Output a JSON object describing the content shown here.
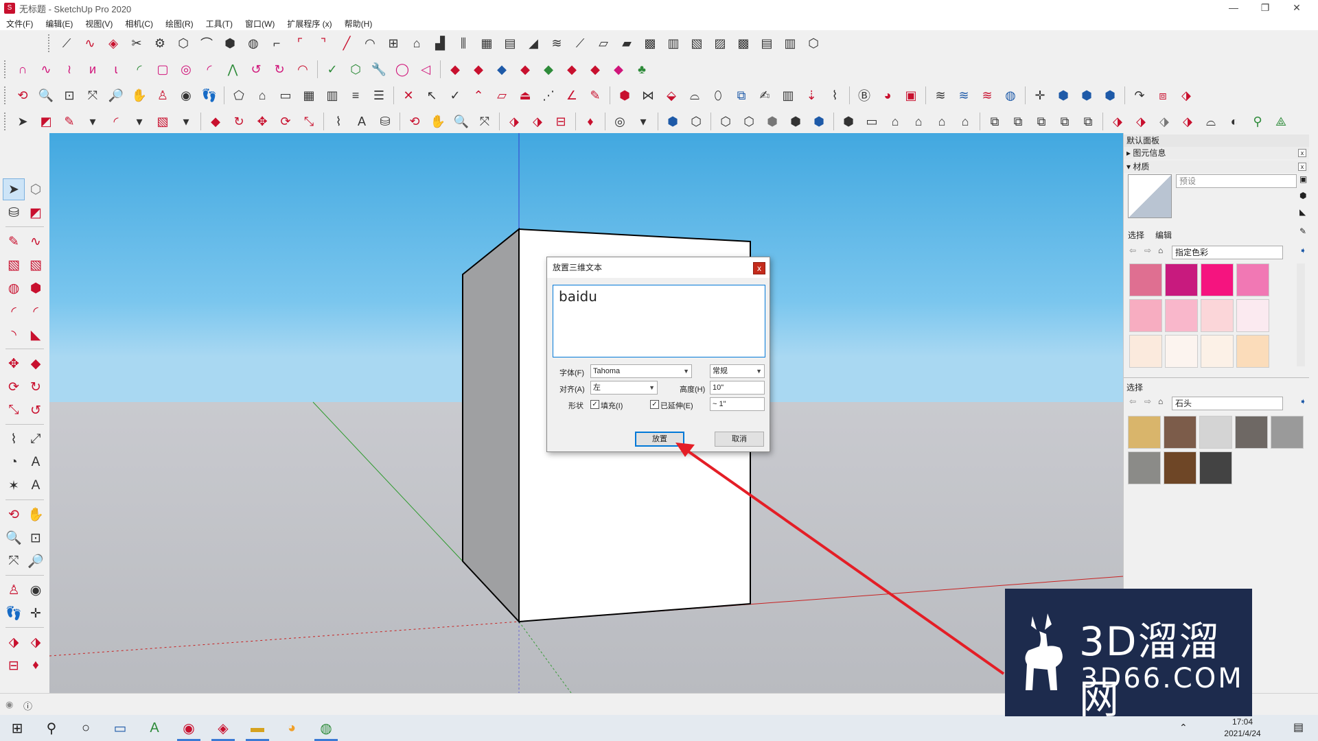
{
  "window": {
    "title": "无标题 - SketchUp Pro 2020",
    "app_icon": "sketchup-icon",
    "controls": [
      "—",
      "❐",
      "✕"
    ]
  },
  "menu": [
    "文件(F)",
    "编辑(E)",
    "视图(V)",
    "相机(C)",
    "绘图(R)",
    "工具(T)",
    "窗口(W)",
    "扩展程序 (x)",
    "帮助(H)"
  ],
  "dialog": {
    "title": "放置三维文本",
    "text_value": "baidu",
    "font_label": "字体(F)",
    "font_value": "Tahoma",
    "style_value": "常规",
    "align_label": "对齐(A)",
    "align_value": "左",
    "height_label": "高度(H)",
    "height_value": "10\"",
    "shape_label": "形状",
    "fill_label": "填充(I)",
    "fill_checked": true,
    "extrude_label": "已延伸(E)",
    "extrude_checked": true,
    "extrude_value": "~ 1\"",
    "place_button": "放置",
    "cancel_button": "取消"
  },
  "tray": {
    "title": "默认面板",
    "entity_info": "图元信息",
    "materials": "材质",
    "preset_name": "预设",
    "tab_select": "选择",
    "tab_edit": "编辑",
    "colors_collection": "指定色彩",
    "colors": [
      "#df6f91",
      "#c81a7e",
      "#f5147f",
      "#f178b4",
      "#f7adc1",
      "#f9b7cb",
      "#fbd6d9",
      "#fbeaf0",
      "#fbeadd",
      "#fcf4ef",
      "#fcf1e7",
      "#fbdcba"
    ],
    "select_label": "选择",
    "stone_collection": "石头",
    "stones": [
      "#d9b56b",
      "#7c5c4a",
      "#d4d4d4",
      "#6e6864",
      "#9a9a9a",
      "#8b8b88",
      "#6e4626",
      "#434343"
    ]
  },
  "taskbar": {
    "time": "17:04",
    "date": "2021/4/24"
  },
  "watermark": {
    "line1": "3D溜溜网",
    "line2": "3D66.COM"
  }
}
